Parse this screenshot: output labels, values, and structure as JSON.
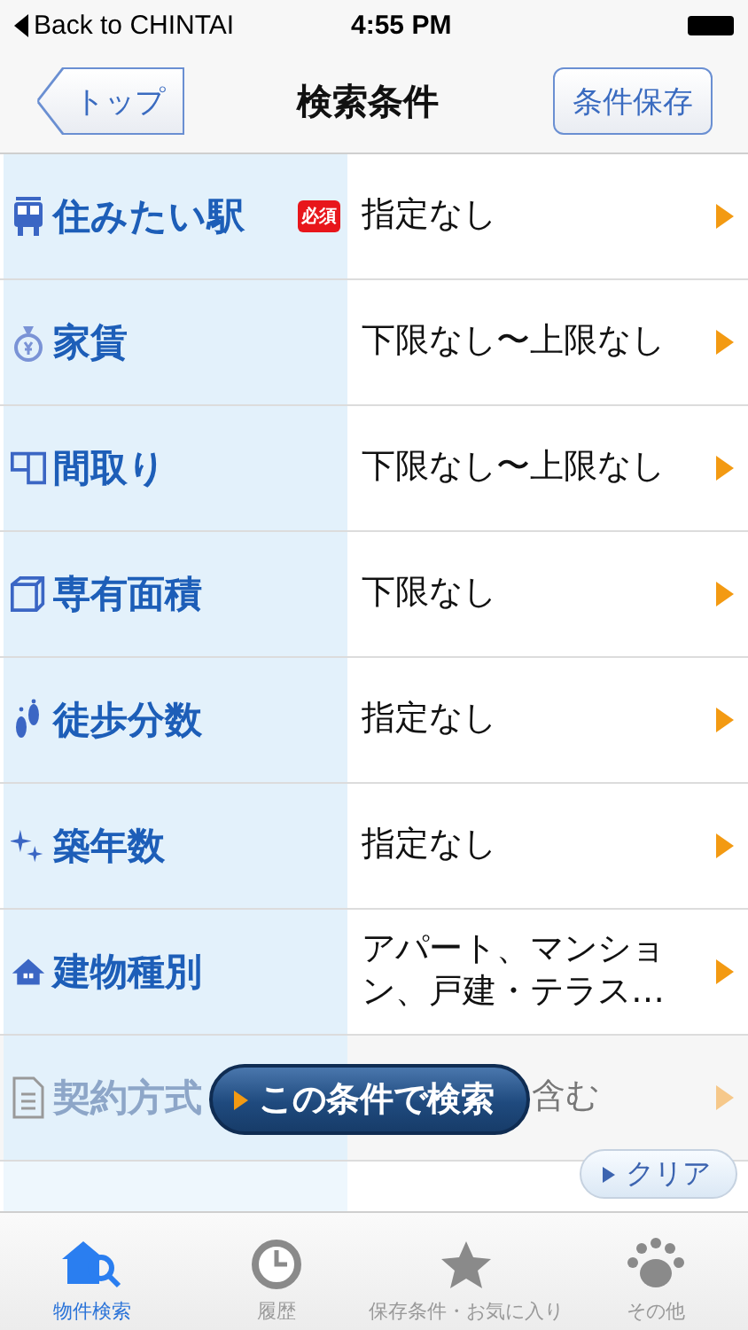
{
  "status_bar": {
    "back": "Back to CHINTAI",
    "time": "4:55 PM"
  },
  "nav": {
    "back": "トップ",
    "title": "検索条件",
    "action": "条件保存"
  },
  "rows": [
    {
      "label": "住みたい駅",
      "required": "必須",
      "value": "指定なし"
    },
    {
      "label": "家賃",
      "value": "下限なし〜上限なし"
    },
    {
      "label": "間取り",
      "value": "下限なし〜上限なし"
    },
    {
      "label": "専有面積",
      "value": "下限なし"
    },
    {
      "label": "徒歩分数",
      "value": "指定なし"
    },
    {
      "label": "築年数",
      "value": "指定なし"
    },
    {
      "label": "建物種別",
      "value": "アパート、マンション、戸建・テラス…"
    },
    {
      "label": "契約方式",
      "value": "含む",
      "kind": "covered"
    }
  ],
  "search_button": "この条件で検索",
  "clear_button": "クリア",
  "tabs": [
    {
      "label": "物件検索",
      "selected": true
    },
    {
      "label": "履歴",
      "selected": false
    },
    {
      "label": "保存条件・お気に入り",
      "selected": false
    },
    {
      "label": "その他",
      "selected": false
    }
  ]
}
